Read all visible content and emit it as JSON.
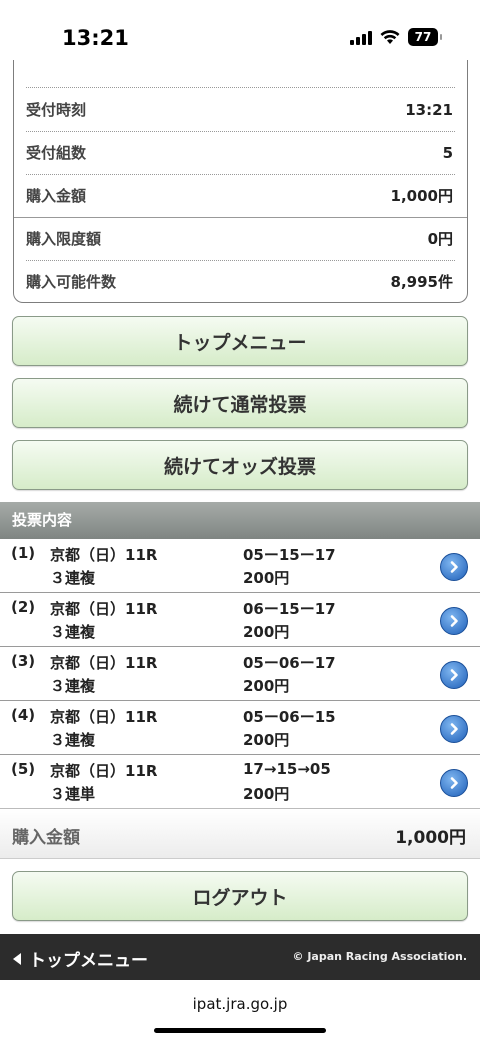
{
  "status_bar": {
    "time": "13:21",
    "battery": "77"
  },
  "summary": {
    "rows": [
      {
        "label": "受付時刻",
        "value": "13:21"
      },
      {
        "label": "受付組数",
        "value": "5"
      },
      {
        "label": "購入金額",
        "value": "1,000円"
      },
      {
        "label": "購入限度額",
        "value": "0円"
      },
      {
        "label": "購入可能件数",
        "value": "8,995件"
      }
    ]
  },
  "buttons": {
    "top_menu": "トップメニュー",
    "continue_normal": "続けて通常投票",
    "continue_odds": "続けてオッズ投票",
    "logout": "ログアウト"
  },
  "bets_section": {
    "title": "投票内容",
    "items": [
      {
        "num": "(1)",
        "race": "京都（日）11R",
        "type": "３連複",
        "combo": "05ー15ー17",
        "amount": "200円"
      },
      {
        "num": "(2)",
        "race": "京都（日）11R",
        "type": "３連複",
        "combo": "06ー15ー17",
        "amount": "200円"
      },
      {
        "num": "(3)",
        "race": "京都（日）11R",
        "type": "３連複",
        "combo": "05ー06ー17",
        "amount": "200円"
      },
      {
        "num": "(4)",
        "race": "京都（日）11R",
        "type": "３連複",
        "combo": "05ー06ー15",
        "amount": "200円"
      },
      {
        "num": "(5)",
        "race": "京都（日）11R",
        "type": "３連単",
        "combo": "17→15→05",
        "amount": "200円"
      }
    ]
  },
  "total": {
    "label": "購入金額",
    "value": "1,000円"
  },
  "footer": {
    "back_label": "トップメニュー",
    "copyright": "© Japan Racing Association."
  },
  "browser": {
    "url": "ipat.jra.go.jp"
  },
  "colors": {
    "button_green": "#d6ecc9",
    "header_gray": "#8e9390",
    "arrow_blue": "#1e5fb8",
    "footer_dark": "#2c2c2c"
  }
}
